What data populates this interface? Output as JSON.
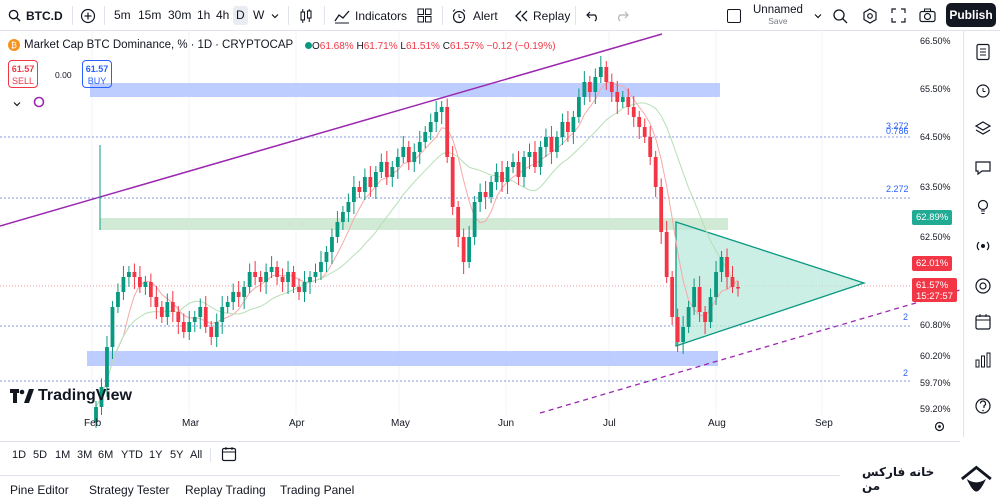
{
  "toolbar": {
    "symbol": "BTC.D",
    "timeframes": [
      "5m",
      "15m",
      "30m",
      "1h",
      "4h",
      "D",
      "W"
    ],
    "active_timeframe": "D",
    "indicators_label": "Indicators",
    "alert_label": "Alert",
    "replay_label": "Replay",
    "layout_name": "Unnamed",
    "layout_status": "Save",
    "publish_label": "Publish"
  },
  "legend": {
    "title": "Market Cap BTC Dominance, %",
    "interval": "1D",
    "source": "CRYPTOCAP",
    "open_label": "O",
    "open": "61.68%",
    "high_label": "H",
    "high": "61.71%",
    "low_label": "L",
    "low": "61.51%",
    "close_label": "C",
    "close": "61.57%",
    "change": "−0.12 (−0.19%)",
    "sell_price": "61.57",
    "sell_label": "SELL",
    "spread": "0.00",
    "buy_price": "61.57",
    "buy_label": "BUY"
  },
  "colors": {
    "up": "#089981",
    "down": "#f23645",
    "zone_blue": "#b2c4ff",
    "zone_green": "#cfe9d4",
    "trendline": "#9c27b0",
    "triangle": "#b9e8dc",
    "ma_fast": "#f7a8a8",
    "ma_slow": "#b5dfb5"
  },
  "price_axis": {
    "labels": [
      "66.50%",
      "65.50%",
      "64.50%",
      "63.50%",
      "62.50%",
      "60.80%",
      "60.20%",
      "59.70%",
      "59.20%"
    ],
    "tag_green": "62.89%",
    "tag_red": "62.01%",
    "tag_price": "61.57%",
    "tag_countdown": "15:27:57"
  },
  "fib_labels": [
    "3.272",
    "0.786",
    "2.272",
    "2",
    "2"
  ],
  "time_axis": [
    "Feb",
    "Mar",
    "Apr",
    "May",
    "Jun",
    "Jul",
    "Aug",
    "Sep"
  ],
  "watermark": "TradingView",
  "range_bar": [
    "1D",
    "5D",
    "1M",
    "3M",
    "6M",
    "YTD",
    "1Y",
    "5Y",
    "All"
  ],
  "bottom_tabs": [
    "Pine Editor",
    "Strategy Tester",
    "Replay Trading",
    "Trading Panel"
  ],
  "brand_text": "خانه فارکس من",
  "chart_data": {
    "type": "candlestick",
    "title": "Market Cap BTC Dominance, %",
    "ylim": [
      59.1,
      66.6
    ],
    "x_range": [
      "Jan 22",
      "Sep 22"
    ],
    "closes": [
      59.2,
      59.6,
      60.4,
      61.2,
      61.5,
      61.8,
      61.9,
      61.8,
      61.6,
      61.7,
      61.4,
      61.2,
      61.0,
      61.3,
      61.1,
      60.9,
      60.7,
      60.9,
      61.0,
      61.2,
      60.8,
      60.6,
      60.9,
      61.2,
      61.3,
      61.5,
      61.4,
      61.6,
      61.9,
      61.8,
      61.7,
      61.9,
      62.0,
      61.8,
      61.7,
      61.9,
      61.6,
      61.5,
      61.7,
      61.8,
      61.9,
      62.1,
      62.3,
      62.6,
      62.9,
      63.1,
      63.3,
      63.6,
      63.5,
      63.8,
      63.6,
      63.9,
      64.1,
      63.8,
      64.0,
      64.2,
      64.4,
      64.1,
      64.3,
      64.5,
      64.7,
      64.9,
      65.1,
      65.2,
      64.2,
      63.2,
      62.6,
      62.1,
      62.6,
      63.3,
      63.5,
      63.4,
      63.7,
      63.9,
      63.7,
      64.0,
      64.1,
      63.8,
      64.2,
      64.3,
      64.0,
      64.4,
      64.6,
      64.3,
      64.6,
      64.9,
      64.7,
      65.0,
      65.4,
      65.7,
      65.5,
      65.8,
      66.0,
      65.7,
      65.5,
      65.3,
      65.4,
      65.2,
      65.0,
      64.8,
      64.6,
      64.2,
      63.6,
      62.7,
      61.8,
      61.0,
      60.5,
      60.8,
      61.2,
      61.6,
      61.1,
      60.9,
      61.4,
      61.9,
      62.2,
      61.8,
      61.6,
      61.57
    ]
  }
}
